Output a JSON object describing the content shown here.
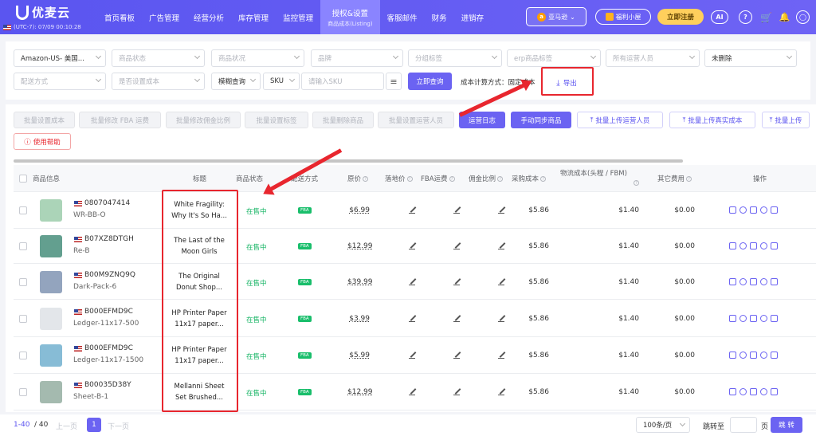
{
  "app": {
    "name": "优麦云",
    "timezone": "(UTC-7): 07/09 00:10:28"
  },
  "nav": {
    "items": [
      "首页看板",
      "广告管理",
      "经营分析",
      "库存管理",
      "监控管理"
    ],
    "active": {
      "label": "授权&设置",
      "sub": "商品成本(Listing)"
    },
    "items_after": [
      "客服邮件",
      "财务",
      "进销存"
    ]
  },
  "header_right": {
    "store": "亚马逊",
    "welfare": "福利小屋",
    "register": "立即注册"
  },
  "filters": {
    "row1": [
      {
        "text": "Amazon-US- 美国...",
        "filled": true
      },
      {
        "text": "商品状态",
        "filled": false
      },
      {
        "text": "商品状况",
        "filled": false
      },
      {
        "text": "品牌",
        "filled": false
      },
      {
        "text": "分组标签",
        "filled": false
      },
      {
        "text": "erp商品标签",
        "filled": false
      },
      {
        "text": "所有运营人员",
        "filled": false
      },
      {
        "text": "未删除",
        "filled": true
      }
    ],
    "row2": {
      "delivery": "配送方式",
      "cost_set": "是否设置成本",
      "match_mode": "模糊查询",
      "sku_type": "SKU",
      "sku_placeholder": "请输入SKU",
      "query_btn": "立即查询",
      "cost_method": "成本计算方式：固定成本",
      "export": "导出"
    }
  },
  "actions": {
    "disabled": [
      "批量设置成本",
      "批量修改 FBA 运费",
      "批量修改佣金比例",
      "批量设置标签",
      "批量删除商品",
      "批量设置运营人员"
    ],
    "primary": [
      "运营日志",
      "手动同步商品"
    ],
    "outline": [
      "批量上传运营人员",
      "批量上传真实成本",
      "批量上传"
    ],
    "help": "使用帮助"
  },
  "table": {
    "headers": {
      "info": "商品信息",
      "title": "标题",
      "status": "商品状态",
      "delivery": "配送方式",
      "price": "原价",
      "landed": "落地价",
      "fba": "FBA运费",
      "commission": "佣金比例",
      "purchase": "采购成本",
      "logistics": "物流成本(头程 / FBM)",
      "other": "其它费用",
      "ops": "操作"
    },
    "rows": [
      {
        "asin": "0807047414",
        "sku": "WR-BB-O",
        "title1": "White Fragility:",
        "title2": "Why It's So Ha...",
        "status": "在售中",
        "delivery": "FBA",
        "price": "$6.99",
        "purchase": "$5.86",
        "logistics": "$1.40",
        "other": "$0.00",
        "thumb_color": "#8fc6a0"
      },
      {
        "asin": "B07XZ8DTGH",
        "sku": "Re-B",
        "title1": "The Last of the",
        "title2": "Moon Girls",
        "status": "在售中",
        "delivery": "FBA",
        "price": "$12.99",
        "purchase": "$5.86",
        "logistics": "$1.40",
        "other": "$0.00",
        "thumb_color": "#2f7f6a"
      },
      {
        "asin": "B00M9ZNQ9Q",
        "sku": "Dark-Pack-6",
        "title1": "The Original",
        "title2": "Donut Shop...",
        "status": "在售中",
        "delivery": "FBA",
        "price": "$39.99",
        "purchase": "$5.86",
        "logistics": "$1.40",
        "other": "$0.00",
        "thumb_color": "#6f86a8"
      },
      {
        "asin": "B000EFMD9C",
        "sku": "Ledger-11x17-500",
        "title1": "HP Printer Paper",
        "title2": "11x17 paper...",
        "status": "在售中",
        "delivery": "FBA",
        "price": "$3.99",
        "purchase": "$5.86",
        "logistics": "$1.40",
        "other": "$0.00",
        "thumb_color": "#d9dde3"
      },
      {
        "asin": "B000EFMD9C",
        "sku": "Ledger-11x17-1500",
        "title1": "HP Printer Paper",
        "title2": "11x17 paper...",
        "status": "在售中",
        "delivery": "FBA",
        "price": "$5.99",
        "purchase": "$5.86",
        "logistics": "$1.40",
        "other": "$0.00",
        "thumb_color": "#5fa6c8"
      },
      {
        "asin": "B00035D38Y",
        "sku": "Sheet-B-1",
        "title1": "Mellanni Sheet",
        "title2": "Set Brushed...",
        "status": "在售中",
        "delivery": "FBA",
        "price": "$12.99",
        "purchase": "$5.86",
        "logistics": "$1.40",
        "other": "$0.00",
        "thumb_color": "#86a394"
      }
    ]
  },
  "pagination": {
    "range": "1-40",
    "total": "/ 40",
    "prev": "上一页",
    "page": "1",
    "next": "下一页",
    "size": "100条/页",
    "goto": "跳转至",
    "page_unit": "页",
    "jump": "跳 转"
  },
  "colors": {
    "primary": "#6b63f2",
    "annotation": "#e8262e",
    "status": "#18b566"
  }
}
